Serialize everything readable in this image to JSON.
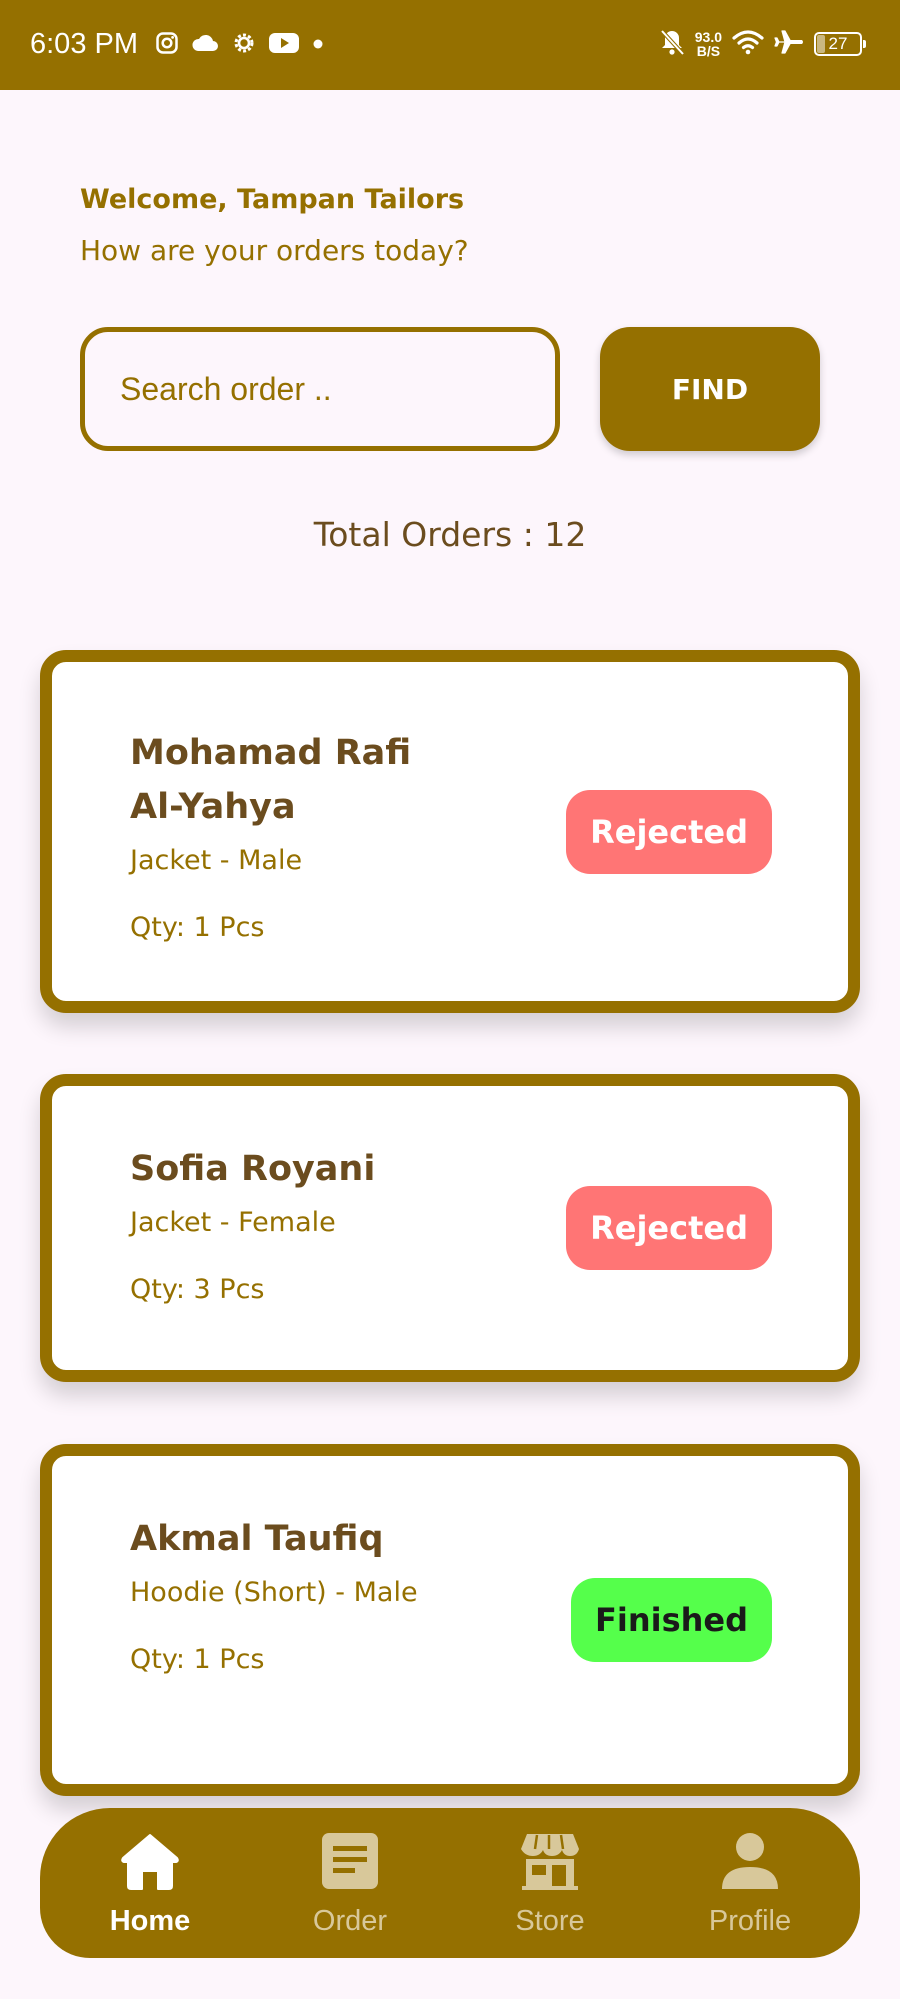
{
  "status_bar": {
    "time": "6:03 PM",
    "left_icons": [
      "instagram-icon",
      "cloud-icon",
      "settings-icon",
      "youtube-icon",
      "dot-icon"
    ],
    "network_speed_value": "93.0",
    "network_speed_unit": "B/S",
    "right_icons": [
      "bell-off-icon",
      "wifi-icon",
      "airplane-icon",
      "battery-icon"
    ],
    "battery_level": "27"
  },
  "header": {
    "welcome": "Welcome, Tampan Tailors",
    "subtitle": "How are your orders today?"
  },
  "search": {
    "placeholder": "Search order ..",
    "value": "",
    "button_label": "FIND"
  },
  "summary": {
    "total_orders_text": "Total Orders : 12"
  },
  "orders": [
    {
      "customer": "Mohamad Rafi Al-Yahya",
      "item": "Jacket - Male",
      "qty": "Qty: 1 Pcs",
      "status": "Rejected"
    },
    {
      "customer": "Sofia Royani",
      "item": "Jacket - Female",
      "qty": "Qty: 3 Pcs",
      "status": "Rejected"
    },
    {
      "customer": "Akmal Taufiq",
      "item": "Hoodie (Short) - Male",
      "qty": "Qty: 1 Pcs",
      "status": "Finished"
    }
  ],
  "nav": {
    "items": [
      {
        "label": "Home",
        "icon": "home-icon",
        "active": true
      },
      {
        "label": "Order",
        "icon": "order-icon",
        "active": false
      },
      {
        "label": "Store",
        "icon": "store-icon",
        "active": false
      },
      {
        "label": "Profile",
        "icon": "profile-icon",
        "active": false
      }
    ]
  },
  "colors": {
    "primary": "#957000",
    "background": "#fdf6fc",
    "heading_brown": "#6b4c1e",
    "rejected": "#ff7575",
    "finished": "#55ff4b",
    "nav_inactive": "#d8c89a"
  }
}
